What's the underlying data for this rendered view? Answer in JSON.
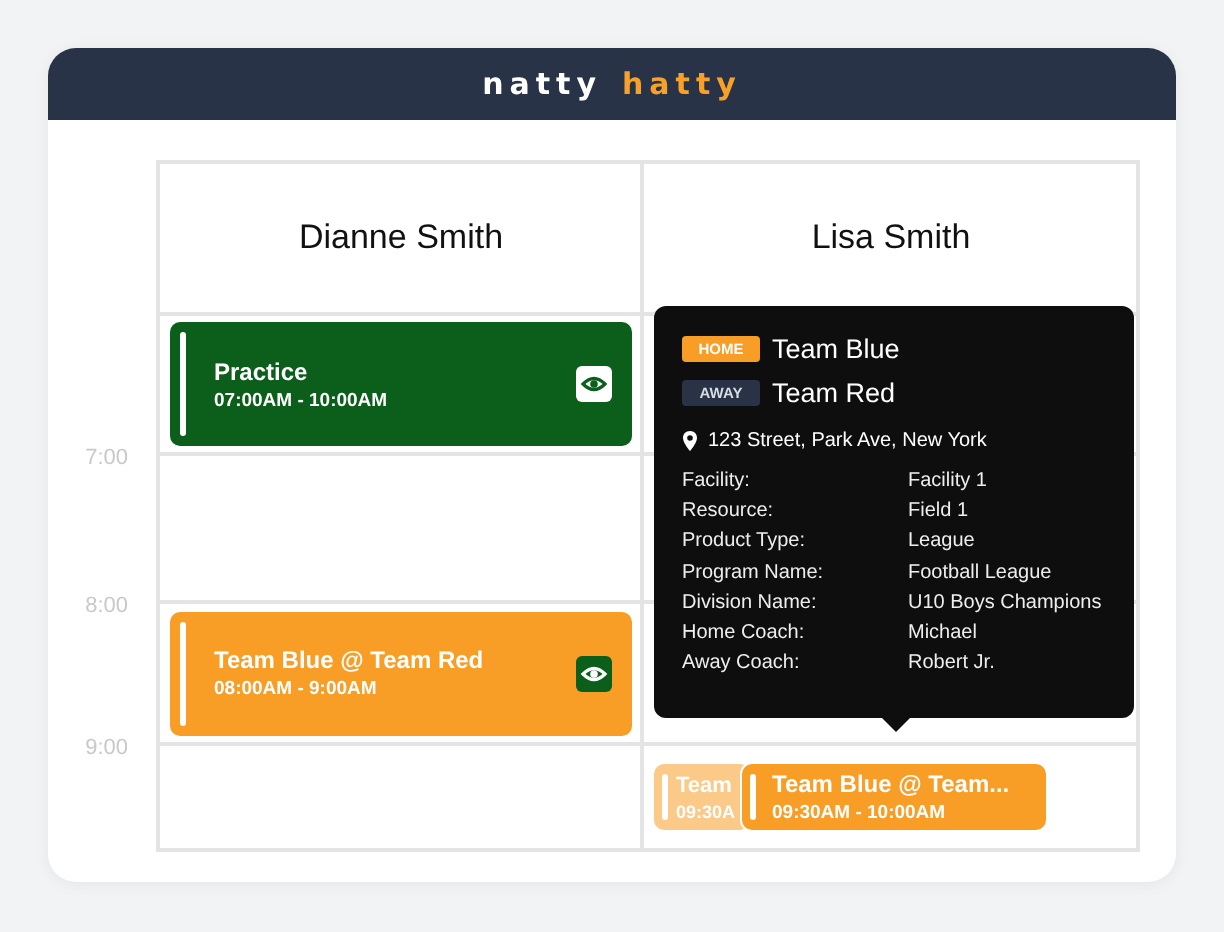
{
  "header": {
    "logo": [
      {
        "text": "natty",
        "color": "#ffffff"
      },
      {
        "text": "hatty",
        "color": "#f7a12a"
      }
    ]
  },
  "columns": [
    {
      "name": "Dianne Smith"
    },
    {
      "name": "Lisa Smith"
    }
  ],
  "rows": [
    {
      "time": "7:00",
      "cells": [
        {
          "kind": "events",
          "events": [
            {
              "kind": "practice",
              "color": "#0c5f1a",
              "title": "Practice",
              "time": "07:00AM - 10:00AM"
            }
          ]
        },
        {
          "kind": "empty"
        }
      ]
    },
    {
      "time": "8:00",
      "cells": [
        {
          "kind": "empty"
        },
        {
          "kind": "empty"
        }
      ]
    },
    {
      "time": "9:00",
      "cells": [
        {
          "kind": "events",
          "events": [
            {
              "kind": "game",
              "color": "#f89e27",
              "title": "Team Blue @ Team Red",
              "time": "08:00AM - 9:00AM"
            }
          ]
        },
        {
          "kind": "empty"
        }
      ]
    },
    {
      "cells": [
        {
          "kind": "empty"
        },
        {
          "kind": "events",
          "events": [
            {
              "kind": "faded",
              "color": "#f89e27",
              "title": "Team",
              "time": "09:30A"
            },
            {
              "kind": "compact",
              "color": "#f89e27",
              "title": "Team Blue @ Team...",
              "time": "09:30AM - 10:00AM"
            }
          ]
        }
      ]
    }
  ],
  "tooltip": {
    "teams": [
      {
        "badge": "HOME",
        "kind": "home",
        "team": "Team Blue"
      },
      {
        "badge": "AWAY",
        "kind": "away",
        "team": "Team Red"
      }
    ],
    "address": "123 Street, Park Ave, New York",
    "details": [
      {
        "label": "Facility:",
        "value": "Facility 1"
      },
      {
        "label": "Resource:",
        "value": "Field 1"
      },
      {
        "label": "Product Type:",
        "value": "League"
      },
      {
        "label": "Program Name:",
        "value": "Football League"
      },
      {
        "label": "Division Name:",
        "value": "U10 Boys Champions"
      },
      {
        "label": "Home Coach:",
        "value": "Michael"
      },
      {
        "label": "Away Coach:",
        "value": "Robert Jr."
      }
    ]
  }
}
